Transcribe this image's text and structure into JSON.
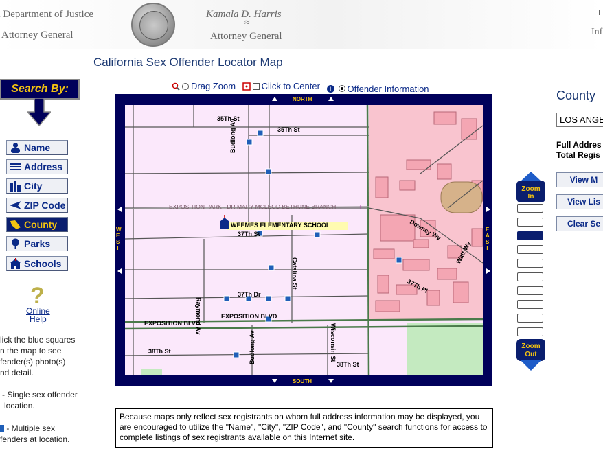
{
  "header": {
    "dept": "a Department of Justice",
    "left_title": "Attorney General",
    "ag_name": "Kamala D. Harris",
    "right_title": "Attorney General",
    "far_right": "Inf"
  },
  "page_title": "California Sex Offender Locator Map",
  "search_by": "Search By:",
  "nav": {
    "name": "Name",
    "address": "Address",
    "city": "City",
    "zip": "ZIP Code",
    "county": "County",
    "parks": "Parks",
    "schools": "Schools"
  },
  "help": {
    "glyph": "?",
    "line1": "Online",
    "line2": "Help"
  },
  "notes": {
    "click_1": "lick the blue squares",
    "click_2": "n the map to see",
    "click_3": "fender(s) photo(s)",
    "click_4": "nd detail.",
    "single_1": "- Single sex offender",
    "single_2": "location.",
    "multi_1": "- Multiple sex",
    "multi_2": "fenders at location."
  },
  "tools": {
    "drag_zoom": "Drag Zoom",
    "click_center": "Click to Center",
    "offender_info": "Offender Information",
    "selected": "offender_info"
  },
  "map": {
    "north": "NORTH",
    "south": "SOUTH",
    "west": "WEST",
    "east": "EAST",
    "streets": {
      "s35th_a": "35Th St",
      "s35th_b": "35Th St",
      "budlong_a": "Budlong Av",
      "expo_park": "EXPOSITION PARK - DR MARY MCLEOD BETHUNE BRANCH",
      "school": "WEEMES ELEMENTARY SCHOOL",
      "s37th": "37Th St",
      "downey": "Downey Wy",
      "watt": "Watt Wy",
      "raymond": "Raymond Av",
      "catalina": "Catalina St",
      "s37thpl": "37Th Pl",
      "s37thdr": "37Th Dr",
      "expo_blvd_a": "EXPOSITION BLVD",
      "expo_blvd_b": "EXPOSITION BLVD",
      "wisconsin": "Wisconsin St",
      "budlong_b": "Budlong Av",
      "s38th_a": "38Th St",
      "s38th_b": "38Th St"
    }
  },
  "zoom": {
    "in": "Zoom In",
    "out": "Zoom Out",
    "levels": 10,
    "current": 3
  },
  "right": {
    "county_label": "County",
    "county_value": "LOS ANGE",
    "full_address": "Full Addres",
    "total_reg": "Total Regis",
    "view_map": "View M",
    "view_list": "View Lis",
    "clear": "Clear Se"
  },
  "disclaimer": "Because maps only reflect sex registrants on whom full address information may be displayed, you are encouraged to utilize the \"Name\", \"City\", \"ZIP Code\", and \"County\" search functions for access to complete listings of sex registrants available on this Internet site.",
  "colors": {
    "navy": "#00005a",
    "gold": "#f3c311",
    "offender_blue": "#1f5fb8",
    "map_bg": "#fbe8fb",
    "map_pink": "#f9c4cf"
  }
}
